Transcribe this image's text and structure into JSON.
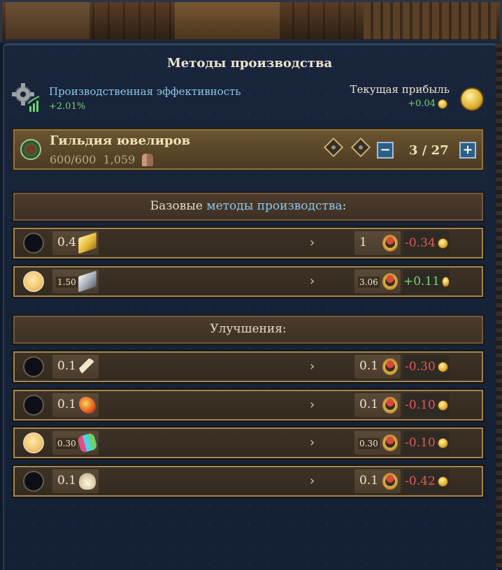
{
  "panel": {
    "title": "Методы производства"
  },
  "efficiency": {
    "label": "Производственная эффективность",
    "value": "+2.01%"
  },
  "profit": {
    "label": "Текущая прибыль",
    "value": "+0.04"
  },
  "guild": {
    "name": "Гильдия ювелиров",
    "employees": "600/600",
    "population": "1,059",
    "count": "3 / 27",
    "minus_label": "−",
    "plus_label": "+"
  },
  "sections": {
    "base": {
      "prefix": "Базовые ",
      "highlight": "методы производства",
      "suffix": ":"
    },
    "upgrades": {
      "label": "Улучшения:"
    }
  },
  "colors": {
    "negative": "#e2585a",
    "positive": "#79d36f",
    "link": "#8ec8ea"
  },
  "base_methods": [
    {
      "selected": false,
      "input_qty": "0.4",
      "input_icon": "gold-bar",
      "output_qty": "1",
      "output_icon": "ring",
      "profit": "-0.34",
      "sign": "neg"
    },
    {
      "selected": true,
      "input_qty": "1.50",
      "input_icon": "silver-bar",
      "output_qty": "3.06",
      "output_icon": "ring",
      "profit": "+0.11",
      "sign": "pos"
    }
  ],
  "upgrades": [
    {
      "selected": false,
      "input_qty": "0.1",
      "input_icon": "ivory",
      "output_qty": "0.1",
      "output_icon": "ring",
      "profit": "-0.30",
      "sign": "neg"
    },
    {
      "selected": false,
      "input_qty": "0.1",
      "input_icon": "amber",
      "output_qty": "0.1",
      "output_icon": "ring",
      "profit": "-0.10",
      "sign": "neg"
    },
    {
      "selected": true,
      "input_qty": "0.30",
      "input_icon": "gems",
      "output_qty": "0.30",
      "output_icon": "ring",
      "profit": "-0.10",
      "sign": "neg"
    },
    {
      "selected": false,
      "input_qty": "0.1",
      "input_icon": "shell",
      "output_qty": "0.1",
      "output_icon": "ring",
      "profit": "-0.42",
      "sign": "neg"
    }
  ]
}
